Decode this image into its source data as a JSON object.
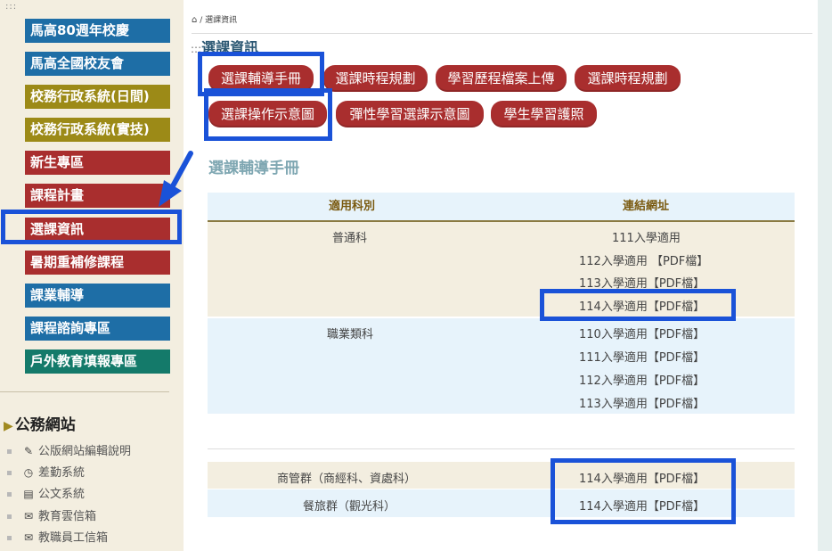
{
  "sidebar": {
    "dots": ":::",
    "nav": [
      {
        "label": "馬高80週年校慶",
        "color": "#1e6ea6"
      },
      {
        "label": "馬高全國校友會",
        "color": "#1e6ea6"
      },
      {
        "label": "校務行政系統(日間)",
        "color": "#9c8a17"
      },
      {
        "label": "校務行政系統(實技)",
        "color": "#9c8a17"
      },
      {
        "label": "新生專區",
        "color": "#a92e2e"
      },
      {
        "label": "課程計畫",
        "color": "#a92e2e"
      },
      {
        "label": "選課資訊",
        "color": "#a92e2e"
      },
      {
        "label": "暑期重補修課程",
        "color": "#a92e2e"
      },
      {
        "label": "課業輔導",
        "color": "#1e6ea6"
      },
      {
        "label": "課程諮詢專區",
        "color": "#1e6ea6"
      },
      {
        "label": "戶外教育填報專區",
        "color": "#147a6a"
      }
    ],
    "public_title": "公務網站",
    "public_items": [
      {
        "label": "公版網站編輯說明",
        "icon": "edit-icon"
      },
      {
        "label": "差勤系統",
        "icon": "clock-icon"
      },
      {
        "label": "公文系統",
        "icon": "document-icon"
      },
      {
        "label": "教育雲信箱",
        "icon": "envelope-outline-icon"
      },
      {
        "label": "教職員工信箱",
        "icon": "envelope-icon"
      }
    ]
  },
  "breadcrumb": {
    "home_icon": "home-icon",
    "sep": "/",
    "current": "選課資訊"
  },
  "page_title": {
    "prefix": ":::",
    "text": "選課資訊"
  },
  "tabs": [
    "選課輔導手冊",
    "選課時程規劃",
    "學習歷程檔案上傳",
    "選課時程規劃",
    "選課操作示意圖",
    "彈性學習選課示意圖",
    "學生學習護照"
  ],
  "section_title": "選課輔導手冊",
  "table": {
    "headers": [
      "適用科別",
      "連結網址"
    ],
    "groups": [
      {
        "category": "普通科",
        "links": [
          "111入學適用",
          "112入學適用 【PDF檔】",
          "113入學適用【PDF檔】",
          "114入學適用【PDF檔】"
        ]
      },
      {
        "category": "職業類科",
        "links": [
          "110入學適用【PDF檔】",
          "111入學適用【PDF檔】",
          "112入學適用【PDF檔】",
          "113入學適用【PDF檔】"
        ]
      }
    ],
    "extra_rows": [
      {
        "category": "商管群（商經科、資處科）",
        "link": "114入學適用【PDF檔】"
      },
      {
        "category": "餐旅群（觀光科）",
        "link": "114入學適用【PDF檔】"
      }
    ]
  },
  "colors": {
    "accent_red": "#a92e2e",
    "highlight_blue": "#1a52d8",
    "title_blue": "#2c5873"
  }
}
